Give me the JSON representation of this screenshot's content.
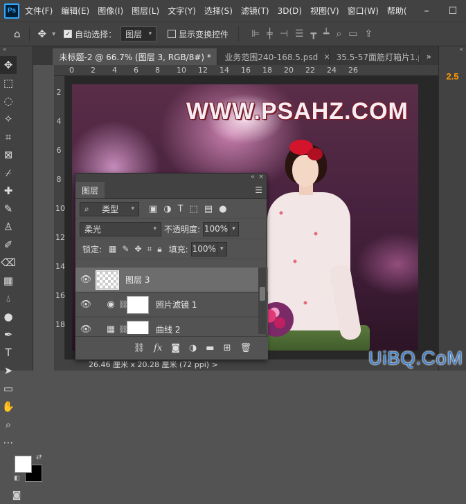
{
  "menubar": {
    "logo": "Ps",
    "items": [
      "文件(F)",
      "编辑(E)",
      "图像(I)",
      "图层(L)",
      "文字(Y)",
      "选择(S)",
      "滤镜(T)",
      "3D(D)",
      "视图(V)",
      "窗口(W)",
      "帮助("
    ],
    "window_buttons": [
      "–",
      "☐"
    ]
  },
  "options": {
    "auto_select_label": "自动选择：",
    "auto_select_value": "图层",
    "show_transform_label": "显示变换控件"
  },
  "tabs": [
    {
      "label": "未标题-2 @ 66.7% (图层 3, RGB/8#) *",
      "active": true
    },
    {
      "label": "业务范围240-168.5.psd",
      "active": false
    },
    {
      "label": "35.5-57面筋灯箱片1.p",
      "active": false
    }
  ],
  "right_panel_badge": "2.5",
  "ruler_h": [
    "0",
    "2",
    "4",
    "6",
    "8",
    "10",
    "12",
    "14",
    "16",
    "18",
    "20",
    "22",
    "24",
    "26"
  ],
  "ruler_v": [
    "2",
    "4",
    "6",
    "8",
    "10",
    "12",
    "14",
    "16",
    "18"
  ],
  "watermark": "WWW.PSAHZ.COM",
  "status": "26.46 厘米 x 20.28 厘米 (72 ppi)  >",
  "layers_panel": {
    "title": "图层",
    "filter_kind": "类型",
    "blend_mode": "柔光",
    "opacity_label": "不透明度:",
    "opacity_value": "100%",
    "lock_label": "锁定:",
    "fill_label": "填充:",
    "fill_value": "100%",
    "layers": [
      {
        "name": "图层 3",
        "selected": true
      },
      {
        "name": "照片滤镜 1",
        "selected": false
      },
      {
        "name": "曲线 2",
        "selected": false
      }
    ]
  },
  "brand": "UiBQ.CoM",
  "colors": {
    "accent": "#31a8ff",
    "badge": "#ff9a00",
    "brand": "#3a7fd0"
  }
}
